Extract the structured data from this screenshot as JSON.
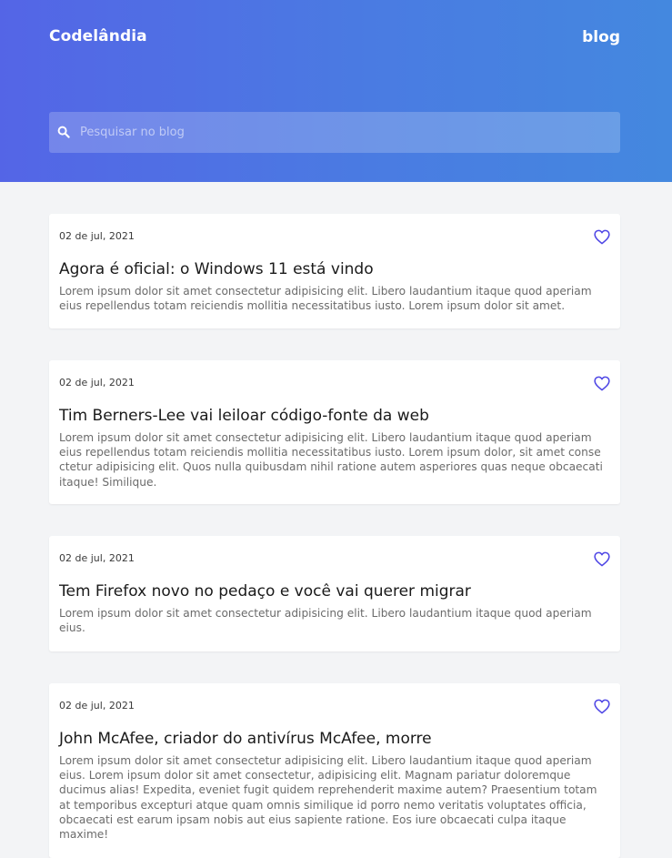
{
  "header": {
    "brand": "Codelândia",
    "nav_blog": "blog",
    "search_placeholder": "Pesquisar no blog"
  },
  "icons": {
    "search": "search-icon",
    "favorite": "heart-icon"
  },
  "colors": {
    "accent": "#4e46e5",
    "header_gradient_start": "#5465e6",
    "header_gradient_end": "#4488df"
  },
  "posts": [
    {
      "date": "02 de jul, 2021",
      "title": "Agora é oficial: o Windows 11 está vindo",
      "text": "Lorem ipsum dolor sit amet consectetur adipisicing elit. Libero laudantium itaque quod aperiam eius repellendus totam reiciendis mollitia necessitatibus iusto. Lorem ipsum dolor sit amet."
    },
    {
      "date": "02 de jul, 2021",
      "title": "Tim Berners-Lee vai leiloar código-fonte da web",
      "text": "Lorem ipsum dolor sit amet consectetur adipisicing elit. Libero laudantium itaque quod aperiam eius repellendus totam reiciendis mollitia necessitatibus iusto. Lorem ipsum dolor, sit amet conse ctetur adipisicing elit. Quos nulla quibusdam nihil ratione autem asperiores quas neque obcaecati itaque! Similique."
    },
    {
      "date": "02 de jul, 2021",
      "title": "Tem Firefox novo no pedaço e você vai querer migrar",
      "text": "Lorem ipsum dolor sit amet consectetur adipisicing elit. Libero laudantium itaque quod aperiam eius."
    },
    {
      "date": "02 de jul, 2021",
      "title": "John McAfee, criador do antivírus McAfee, morre",
      "text": "Lorem ipsum dolor sit amet consectetur adipisicing elit. Libero laudantium itaque quod aperiam eius. Lorem ipsum dolor sit amet consectetur, adipisicing elit. Magnam pariatur doloremque ducimus alias! Expedita, eveniet fugit quidem reprehenderit maxime autem? Praesentium totam at temporibus excepturi atque quam omnis similique id porro nemo veritatis voluptates officia, obcaecati est earum ipsam nobis aut eius sapiente ratione. Eos iure obcaecati culpa itaque maxime!"
    }
  ]
}
